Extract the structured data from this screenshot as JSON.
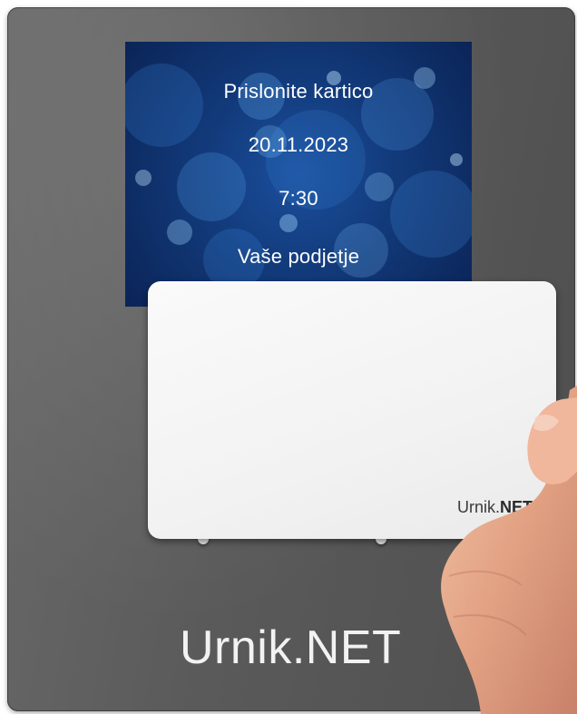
{
  "screen": {
    "prompt": "Prislonite kartico",
    "date": "20.11.2023",
    "time": "7:30",
    "company": "Vaše podjetje"
  },
  "card": {
    "logo_main": "Urnik.",
    "logo_bold": "NET"
  },
  "device": {
    "brand": "Urnik.NET"
  },
  "colors": {
    "device_body": "#5a5a5a",
    "screen_bg": "#123a7a",
    "card": "#f2f2f2"
  }
}
